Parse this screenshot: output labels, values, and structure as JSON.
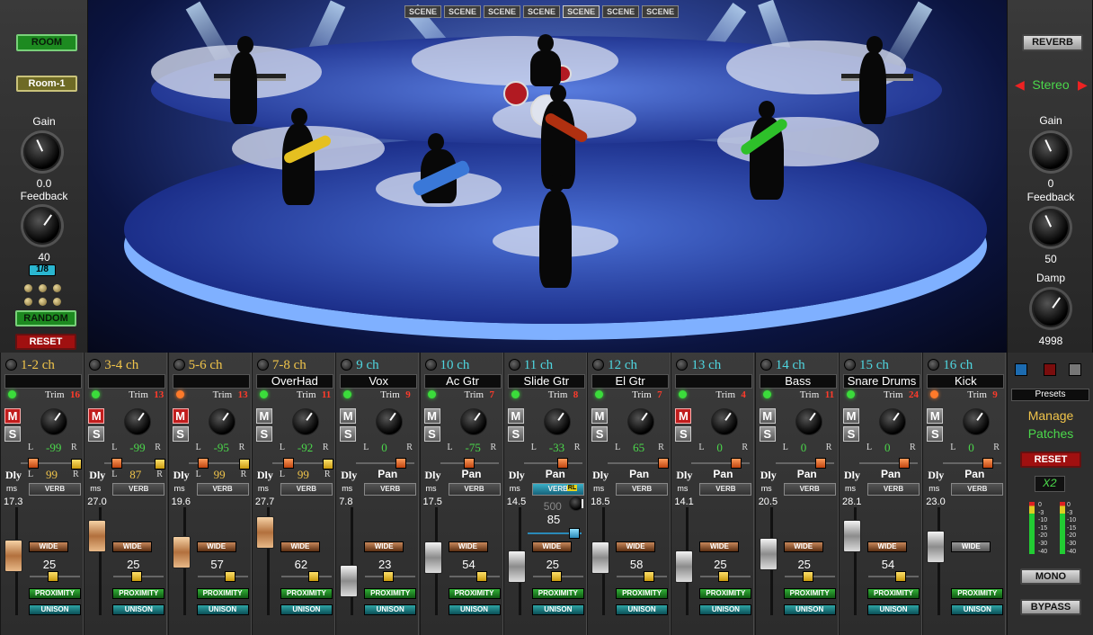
{
  "left_panel": {
    "room_button": "ROOM",
    "room_preset": "Room-1",
    "gain_label": "Gain",
    "gain_value": "0.0",
    "feedback_label": "Feedback",
    "feedback_value": "40",
    "delay_sync": "1/8",
    "random_button": "RANDOM",
    "reset_button": "RESET"
  },
  "right_panel": {
    "reverb_button": "REVERB",
    "stereo_label": "Stereo",
    "gain_label": "Gain",
    "gain_value": "0",
    "feedback_label": "Feedback",
    "feedback_value": "50",
    "damp_label": "Damp",
    "damp_value": "4998"
  },
  "scenes": [
    "SCENE",
    "SCENE",
    "SCENE",
    "SCENE",
    "SCENE",
    "SCENE",
    "SCENE"
  ],
  "channels": [
    {
      "label": "1-2 ch",
      "name": "",
      "trim_label": "Trim",
      "trim": "16",
      "mute": "M",
      "solo": "S",
      "muted": true,
      "lr_l": "L",
      "lr_r": "R",
      "lr_value": "-99",
      "dly_label": "Dly",
      "dly_l": "L",
      "dly_value": "99",
      "dly_r": "R",
      "ms_label": "ms",
      "ms_value": "17.3",
      "verb": "VERB",
      "wide": "WIDE",
      "wide_value": "25",
      "proximity": "PROXIMITY",
      "unison": "UNISON"
    },
    {
      "label": "3-4 ch",
      "name": "",
      "trim_label": "Trim",
      "trim": "13",
      "mute": "M",
      "solo": "S",
      "muted": true,
      "lr_l": "L",
      "lr_r": "R",
      "lr_value": "-99",
      "dly_label": "Dly",
      "dly_l": "L",
      "dly_value": "87",
      "dly_r": "R",
      "ms_label": "ms",
      "ms_value": "27.0",
      "verb": "VERB",
      "wide": "WIDE",
      "wide_value": "25",
      "proximity": "PROXIMITY",
      "unison": "UNISON"
    },
    {
      "label": "5-6 ch",
      "name": "",
      "trim_label": "Trim",
      "trim": "13",
      "mute": "M",
      "solo": "S",
      "muted": true,
      "lr_l": "L",
      "lr_r": "R",
      "lr_value": "-95",
      "dly_label": "Dly",
      "dly_l": "L",
      "dly_value": "99",
      "dly_r": "R",
      "ms_label": "ms",
      "ms_value": "19.6",
      "verb": "VERB",
      "wide": "WIDE",
      "wide_value": "57",
      "proximity": "PROXIMITY",
      "unison": "UNISON"
    },
    {
      "label": "7-8 ch",
      "name": "OverHad",
      "trim_label": "Trim",
      "trim": "11",
      "mute": "M",
      "solo": "S",
      "muted": false,
      "lr_l": "L",
      "lr_r": "R",
      "lr_value": "-92",
      "dly_label": "Dly",
      "dly_l": "L",
      "dly_value": "99",
      "dly_r": "R",
      "ms_label": "ms",
      "ms_value": "27.7",
      "verb": "VERB",
      "wide": "WIDE",
      "wide_value": "62",
      "proximity": "PROXIMITY",
      "unison": "UNISON"
    },
    {
      "label": "9 ch",
      "name": "Vox",
      "trim_label": "Trim",
      "trim": "9",
      "mute": "M",
      "solo": "S",
      "muted": false,
      "lr_l": "L",
      "lr_r": "R",
      "lr_value": "0",
      "dly_label": "Dly",
      "pan_label": "Pan",
      "ms_label": "ms",
      "ms_value": "7.8",
      "verb": "VERB",
      "wide": "WIDE",
      "wide_value": "23",
      "proximity": "PROXIMITY",
      "unison": "UNISON"
    },
    {
      "label": "10 ch",
      "name": "Ac Gtr",
      "trim_label": "Trim",
      "trim": "7",
      "mute": "M",
      "solo": "S",
      "muted": false,
      "lr_l": "L",
      "lr_r": "R",
      "lr_value": "-75",
      "dly_label": "Dly",
      "pan_label": "Pan",
      "ms_label": "ms",
      "ms_value": "17.5",
      "verb": "VERB",
      "wide": "WIDE",
      "wide_value": "54",
      "proximity": "PROXIMITY",
      "unison": "UNISON"
    },
    {
      "label": "11 ch",
      "name": "Slide Gtr",
      "trim_label": "Trim",
      "trim": "8",
      "mute": "M",
      "solo": "S",
      "muted": false,
      "lr_l": "L",
      "lr_r": "R",
      "lr_value": "-33",
      "dly_label": "Dly",
      "pan_label": "Pan",
      "ms_label": "ms",
      "ms_value": "14.5",
      "verb": "VERB",
      "verb_on": true,
      "rl": "RL",
      "verb_time": "500",
      "verb_amount": "85",
      "wide": "WIDE",
      "wide_value": "25",
      "proximity": "PROXIMITY",
      "unison": "UNISON"
    },
    {
      "label": "12 ch",
      "name": "El Gtr",
      "trim_label": "Trim",
      "trim": "7",
      "mute": "M",
      "solo": "S",
      "muted": false,
      "lr_l": "L",
      "lr_r": "R",
      "lr_value": "65",
      "dly_label": "Dly",
      "pan_label": "Pan",
      "ms_label": "ms",
      "ms_value": "18.5",
      "verb": "VERB",
      "wide": "WIDE",
      "wide_value": "58",
      "proximity": "PROXIMITY",
      "unison": "UNISON"
    },
    {
      "label": "13 ch",
      "name": "",
      "trim_label": "Trim",
      "trim": "4",
      "mute": "M",
      "solo": "S",
      "muted": true,
      "lr_l": "L",
      "lr_r": "R",
      "lr_value": "0",
      "dly_label": "Dly",
      "pan_label": "Pan",
      "ms_label": "ms",
      "ms_value": "14.1",
      "verb": "VERB",
      "wide": "WIDE",
      "wide_value": "25",
      "proximity": "PROXIMITY",
      "unison": "UNISON"
    },
    {
      "label": "14 ch",
      "name": "Bass",
      "trim_label": "Trim",
      "trim": "11",
      "mute": "M",
      "solo": "S",
      "muted": false,
      "lr_l": "L",
      "lr_r": "R",
      "lr_value": "0",
      "dly_label": "Dly",
      "pan_label": "Pan",
      "ms_label": "ms",
      "ms_value": "20.5",
      "verb": "VERB",
      "wide": "WIDE",
      "wide_value": "25",
      "proximity": "PROXIMITY",
      "unison": "UNISON"
    },
    {
      "label": "15 ch",
      "name": "Snare Drums",
      "trim_label": "Trim",
      "trim": "24",
      "mute": "M",
      "solo": "S",
      "muted": false,
      "lr_l": "L",
      "lr_r": "R",
      "lr_value": "0",
      "dly_label": "Dly",
      "pan_label": "Pan",
      "ms_label": "ms",
      "ms_value": "28.1",
      "verb": "VERB",
      "wide": "WIDE",
      "wide_value": "54",
      "proximity": "PROXIMITY",
      "unison": "UNISON"
    },
    {
      "label": "16 ch",
      "name": "Kick",
      "trim_label": "Trim",
      "trim": "9",
      "mute": "M",
      "solo": "S",
      "muted": false,
      "lr_l": "L",
      "lr_r": "R",
      "lr_value": "0",
      "dly_label": "Dly",
      "pan_label": "Pan",
      "ms_label": "ms",
      "ms_value": "23.0",
      "verb": "VERB",
      "wide": "WIDE",
      "wide_value": "",
      "proximity": "PROXIMITY",
      "unison": "UNISON"
    }
  ],
  "side": {
    "presets_label": "Presets",
    "manage": "Manage",
    "patches": "Patches",
    "reset": "RESET",
    "x2": "X2",
    "meter_ticks": [
      "0",
      "-3",
      "-10",
      "-15",
      "-20",
      "-30",
      "-40"
    ],
    "mono": "MONO",
    "bypass": "BYPASS"
  },
  "colors": {
    "channel_label_stereo": "#f0c44a",
    "channel_label_mono": "#4fd6e0",
    "trim_value": "#ff3b2b",
    "value_green": "#4bd84b"
  }
}
